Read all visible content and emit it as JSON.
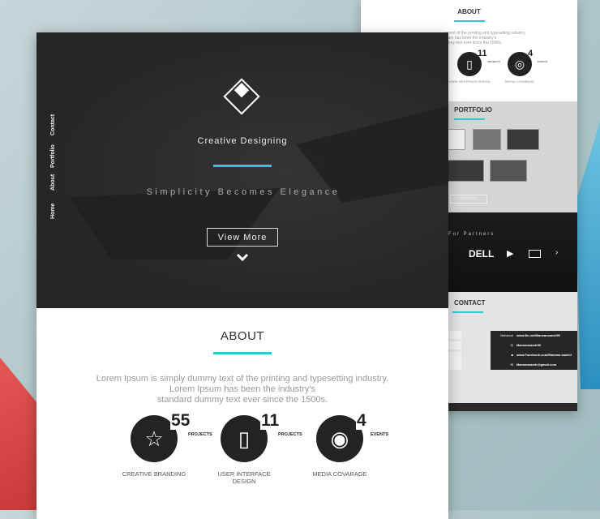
{
  "accent": "#2ec8cf",
  "nav": [
    "Home",
    "About",
    "Portfolio",
    "Contact"
  ],
  "hero": {
    "title": "Creative Designing",
    "subtitle": "Simplicity Becomes Elegance",
    "button": "View More"
  },
  "about": {
    "title": "ABOUT",
    "text_lines": [
      "Lorem Ipsum is simply dummy text of the printing and typesetting industry.",
      "Lorem Ipsum has been the industry's",
      "standard dummy text ever since the 1500s."
    ],
    "stats": [
      {
        "icon": "star-icon",
        "number": "55",
        "unit": "PROJECTS",
        "label": "CREATIVE BRANDING"
      },
      {
        "icon": "devices-icon",
        "number": "11",
        "unit": "PROJECTS",
        "label": "USER INTERFACE DESIGN"
      },
      {
        "icon": "camera-icon",
        "number": "4",
        "unit": "EVENTS",
        "label": "MEDIA COVARAGE"
      }
    ]
  },
  "back": {
    "about_title": "ABOUT",
    "about_text": [
      "y text of the printing and typesetting industry.",
      "sum has been the industry's",
      "mmy text ever since the 1500s."
    ],
    "stats": [
      {
        "number": "11",
        "unit": "PROJECTS",
        "label": "USER INTERFACE DESIGN"
      },
      {
        "number": "4",
        "unit": "EVENTS",
        "label": "MEDIA COVARAGE"
      }
    ],
    "portfolio_title": "PORTFOLIO",
    "view_more": "View More",
    "partners_title": "For Partners",
    "partner_logo": "DELL",
    "contact_title": "CONTACT",
    "contact": [
      {
        "label": "Behance",
        "value": "www.Be.net/Marwansamir99"
      },
      {
        "label": "instagram-icon",
        "value": "Marwansamir99"
      },
      {
        "label": "facebook-icon",
        "value": "www.Facebook.com/Marwan.samir2"
      },
      {
        "label": "mail-icon",
        "value": "Marwansamir@gmail.com"
      }
    ]
  }
}
